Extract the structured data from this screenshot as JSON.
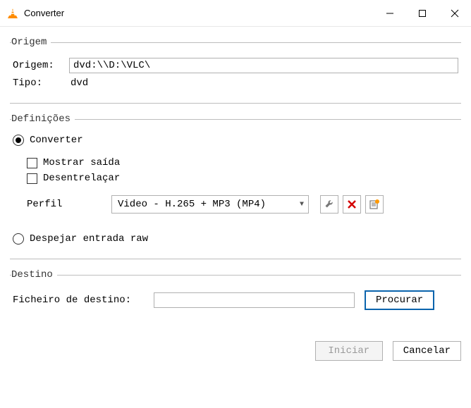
{
  "window": {
    "title": "Converter"
  },
  "origem": {
    "legend": "Origem",
    "source_label": "Origem:",
    "source_value": "dvd:\\\\D:\\VLC\\",
    "type_label": "Tipo:",
    "type_value": "dvd"
  },
  "defs": {
    "legend": "Definições",
    "convert_option": "Converter",
    "show_output": "Mostrar saída",
    "deinterlace": "Desentrelaçar",
    "profile_label": "Perfil",
    "profile_value": "Video - H.265 + MP3 (MP4)",
    "dump_option": "Despejar entrada raw"
  },
  "destino": {
    "legend": "Destino",
    "file_label": "Ficheiro de destino:",
    "file_value": "",
    "browse": "Procurar"
  },
  "footer": {
    "start": "Iniciar",
    "cancel": "Cancelar"
  },
  "icons": {
    "wrench": "wrench-icon",
    "delete": "delete-icon",
    "new_profile": "new-profile-icon"
  }
}
